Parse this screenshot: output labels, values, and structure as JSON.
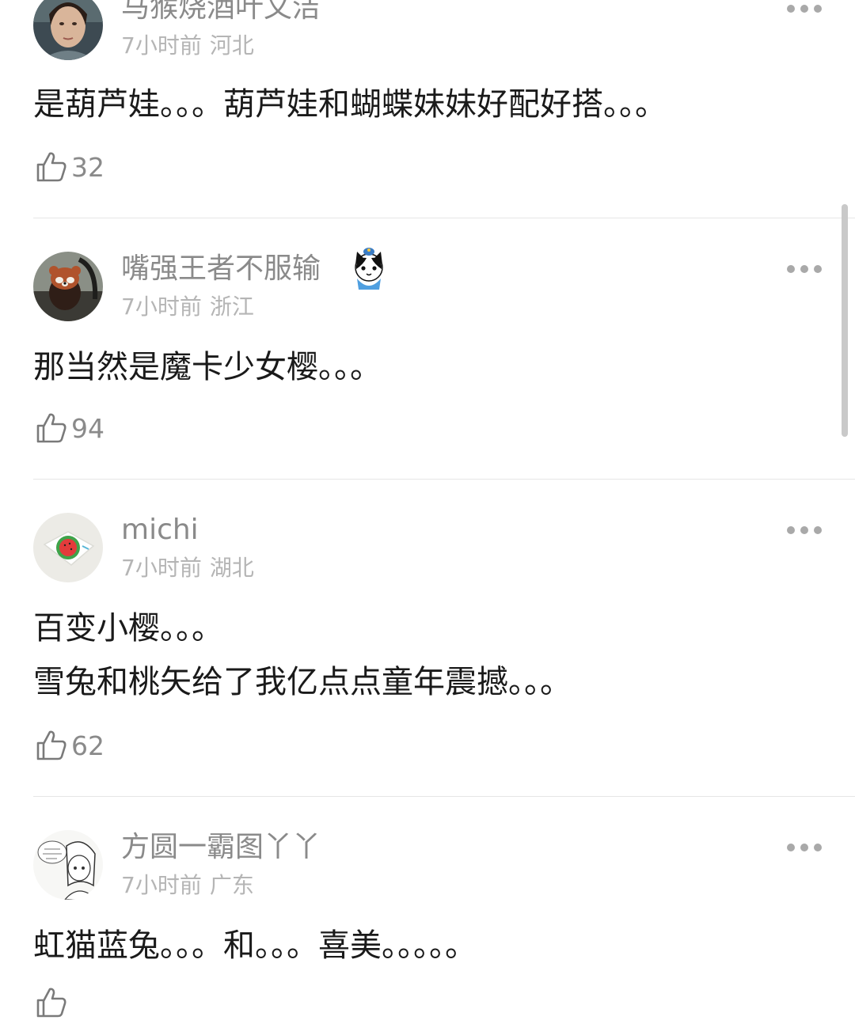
{
  "comments": [
    {
      "username": "马猴烧酒叶文洁",
      "time": "7小时前",
      "location": "河北",
      "lines": [
        "是葫芦娃。。。葫芦娃和蝴蝶妹妹好配好搭。。。"
      ],
      "likes": "32",
      "avatar": "woman-portrait-avatar"
    },
    {
      "username": "嘴强王者不服输",
      "time": "7小时前",
      "location": "浙江",
      "lines": [
        "那当然是魔卡少女樱。。。"
      ],
      "likes": "94",
      "avatar": "red-panda-avatar",
      "badge": "cat-badge-icon"
    },
    {
      "username": "michi",
      "time": "7小时前",
      "location": "湖北",
      "lines": [
        "百变小樱。。。",
        "雪兔和桃矢给了我亿点点童年震撼。。。"
      ],
      "likes": "62",
      "avatar": "watermelon-candy-avatar"
    },
    {
      "username": "方圆一霸图丫丫",
      "time": "7小时前",
      "location": "广东",
      "lines": [
        "虹猫蓝兔。。。和。。。喜美。。。。。"
      ],
      "likes": "",
      "avatar": "manga-girl-avatar"
    }
  ],
  "icons": {
    "like": "thumbs-up-icon",
    "more": "more-dots-icon"
  },
  "colors": {
    "username": "#8a8a8a",
    "meta": "#b5b5b5",
    "text": "#1a1a1a",
    "divider": "#e6e6e6"
  }
}
